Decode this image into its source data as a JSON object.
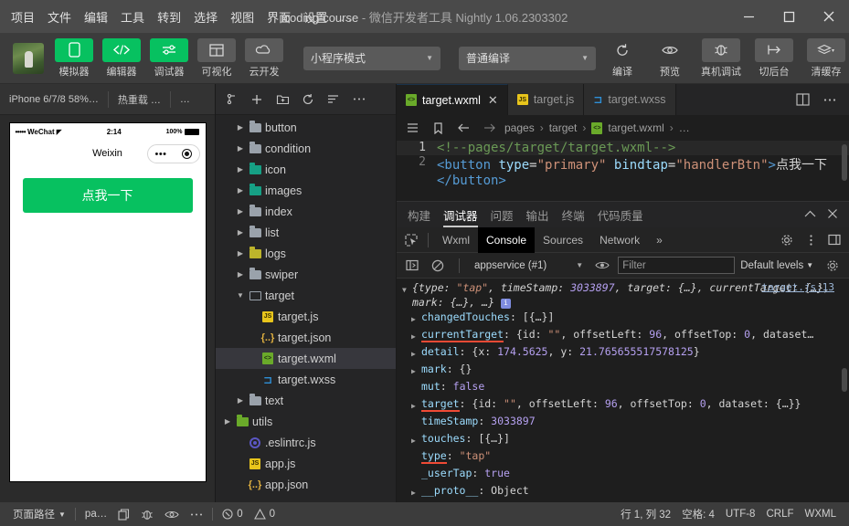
{
  "window": {
    "title_project": "icoding-course",
    "title_dash": "-",
    "title_app": "微信开发者工具",
    "title_version": "Nightly 1.06.2303302",
    "minimize": "minimize-icon",
    "maximize": "maximize-icon",
    "close": "close-icon"
  },
  "menu": {
    "items": [
      {
        "label": "项目"
      },
      {
        "label": "文件"
      },
      {
        "label": "编辑"
      },
      {
        "label": "工具"
      },
      {
        "label": "转到"
      },
      {
        "label": "选择"
      },
      {
        "label": "视图"
      },
      {
        "label": "界面"
      },
      {
        "label": "设置"
      },
      {
        "label": "…"
      }
    ]
  },
  "toolbar": {
    "left_buttons": [
      {
        "label": "模拟器",
        "icon": "phone-icon",
        "state": "green"
      },
      {
        "label": "编辑器",
        "icon": "code-icon",
        "state": "green"
      },
      {
        "label": "调试器",
        "icon": "sliders-icon",
        "state": "green"
      },
      {
        "label": "可视化",
        "icon": "layout-icon",
        "state": "grey"
      },
      {
        "label": "云开发",
        "icon": "cloud-icon",
        "state": "grey"
      }
    ],
    "mode_select": "小程序模式",
    "compile_select": "普通编译",
    "right_buttons": [
      {
        "label": "编译",
        "icon": "refresh-icon"
      },
      {
        "label": "预览",
        "icon": "eye-icon"
      },
      {
        "label": "真机调试",
        "icon": "bug-icon"
      },
      {
        "label": "切后台",
        "icon": "background-icon"
      },
      {
        "label": "清缓存",
        "icon": "layers-icon"
      }
    ],
    "overflow": "»"
  },
  "simulator": {
    "device": "iPhone 6/7/8 58%…",
    "hot_reload": "热重载 …",
    "more": "…",
    "phone": {
      "carrier": "WeChat",
      "signal_dots": "•••••",
      "wifi_icon": "wifi-icon",
      "time": "2:14",
      "battery_pct": "100%",
      "nav_title": "Weixin",
      "capsule_more": "•••",
      "capsule_target": "target-icon",
      "button_label": "点我一下"
    }
  },
  "explorer": {
    "toolbar_icons": [
      "collapse-icon",
      "new-file-icon",
      "new-folder-icon",
      "refresh-icon",
      "sort-icon",
      "more-icon"
    ],
    "tree": [
      {
        "label": "button",
        "type": "folder",
        "icon": "folder-grey",
        "arrow": "right",
        "indent": 1,
        "selected": false
      },
      {
        "label": "condition",
        "type": "folder",
        "icon": "folder-grey",
        "arrow": "right",
        "indent": 1,
        "selected": false
      },
      {
        "label": "icon",
        "type": "folder",
        "icon": "folder-teal",
        "arrow": "right",
        "indent": 1,
        "selected": false
      },
      {
        "label": "images",
        "type": "folder",
        "icon": "folder-teal",
        "arrow": "right",
        "indent": 1,
        "selected": false
      },
      {
        "label": "index",
        "type": "folder",
        "icon": "folder-grey",
        "arrow": "right",
        "indent": 1,
        "selected": false
      },
      {
        "label": "list",
        "type": "folder",
        "icon": "folder-grey",
        "arrow": "right",
        "indent": 1,
        "selected": false
      },
      {
        "label": "logs",
        "type": "folder",
        "icon": "folder-yellow",
        "arrow": "right",
        "indent": 1,
        "selected": false
      },
      {
        "label": "swiper",
        "type": "folder",
        "icon": "folder-grey",
        "arrow": "right",
        "indent": 1,
        "selected": false
      },
      {
        "label": "target",
        "type": "folder-open",
        "icon": "folder-open",
        "arrow": "down",
        "indent": 1,
        "selected": false
      },
      {
        "label": "target.js",
        "type": "file",
        "icon": "js-icon",
        "arrow": "none",
        "indent": 2,
        "selected": false
      },
      {
        "label": "target.json",
        "type": "file",
        "icon": "json-icon",
        "arrow": "none",
        "indent": 2,
        "selected": false
      },
      {
        "label": "target.wxml",
        "type": "file",
        "icon": "wxml-icon",
        "arrow": "none",
        "indent": 2,
        "selected": true
      },
      {
        "label": "target.wxss",
        "type": "file",
        "icon": "wxss-icon",
        "arrow": "none",
        "indent": 2,
        "selected": false
      },
      {
        "label": "text",
        "type": "folder",
        "icon": "folder-grey",
        "arrow": "right",
        "indent": 1,
        "selected": false
      },
      {
        "label": "utils",
        "type": "folder",
        "icon": "folder-green",
        "arrow": "right",
        "indent": 0,
        "selected": false
      },
      {
        "label": ".eslintrc.js",
        "type": "file",
        "icon": "eslint-icon",
        "arrow": "none",
        "indent": 1,
        "selected": false
      },
      {
        "label": "app.js",
        "type": "file",
        "icon": "js-icon",
        "arrow": "none",
        "indent": 1,
        "selected": false
      },
      {
        "label": "app.json",
        "type": "file",
        "icon": "json-icon",
        "arrow": "none",
        "indent": 1,
        "selected": false
      }
    ]
  },
  "editor": {
    "tabs": [
      {
        "label": "target.wxml",
        "icon": "wxml-icon",
        "active": true,
        "closable": true
      },
      {
        "label": "target.js",
        "icon": "js-icon",
        "active": false,
        "closable": false
      },
      {
        "label": "target.wxss",
        "icon": "wxss-icon",
        "active": false,
        "closable": false
      }
    ],
    "tab_actions": [
      "split-editor-icon",
      "more-icon"
    ],
    "breadcrumb": {
      "nav_icons": [
        "outline-icon",
        "bookmark-icon",
        "back-icon",
        "forward-icon"
      ],
      "parts": [
        "pages",
        "target",
        "target.wxml",
        "…"
      ],
      "separator": "›",
      "file_icon": "wxml-icon"
    },
    "lines": [
      {
        "number": "1",
        "highlight": true,
        "tokens": [
          {
            "text": "<!--",
            "cls": "c-comment br"
          },
          {
            "text": "pages/target/target.wxml",
            "cls": "c-comment"
          },
          {
            "text": "-->",
            "cls": "c-comment br"
          }
        ]
      },
      {
        "number": "2",
        "highlight": false,
        "tokens": [
          {
            "text": "<button",
            "cls": "c-tag"
          },
          {
            "text": " ",
            "cls": "c-txt"
          },
          {
            "text": "type",
            "cls": "c-attr"
          },
          {
            "text": "=",
            "cls": "c-txt"
          },
          {
            "text": "\"primary\"",
            "cls": "c-str"
          },
          {
            "text": " ",
            "cls": "c-txt"
          },
          {
            "text": "bindtap",
            "cls": "c-attr"
          },
          {
            "text": "=",
            "cls": "c-txt"
          },
          {
            "text": "\"handlerBtn\"",
            "cls": "c-str"
          },
          {
            "text": ">",
            "cls": "c-tag"
          },
          {
            "text": "点我一下",
            "cls": "c-txt"
          },
          {
            "text": "</button>",
            "cls": "c-tag"
          }
        ]
      }
    ]
  },
  "debugger": {
    "panel_tabs": [
      {
        "label": "构建",
        "active": false
      },
      {
        "label": "调试器",
        "active": true
      },
      {
        "label": "问题",
        "active": false
      },
      {
        "label": "输出",
        "active": false
      },
      {
        "label": "终端",
        "active": false
      },
      {
        "label": "代码质量",
        "active": false
      }
    ],
    "panel_actions": [
      "chevron-up-icon",
      "close-icon"
    ],
    "devtools_tabs": [
      {
        "label": "Wxml",
        "active": false
      },
      {
        "label": "Console",
        "active": true
      },
      {
        "label": "Sources",
        "active": false
      },
      {
        "label": "Network",
        "active": false
      },
      {
        "label": "»",
        "active": false
      }
    ],
    "devtools_left_icon": "inspect-icon",
    "devtools_right_icons": [
      "gear-icon",
      "kebab-icon",
      "dock-icon"
    ],
    "console_toolbar": {
      "sidebar_icon": "console-sidebar-icon",
      "clear_icon": "clear-console-icon",
      "context": "appservice (#1)",
      "eye_icon": "eye-icon",
      "filter_placeholder": "Filter",
      "levels": "Default levels",
      "settings_icon": "gear-icon"
    },
    "console": {
      "source_link": "target.js:13",
      "rows": [
        {
          "tri": "down",
          "italic": true,
          "tokens": [
            {
              "t": "{type: ",
              "c": "p"
            },
            {
              "t": "\"tap\"",
              "c": "s"
            },
            {
              "t": ", timeStamp: ",
              "c": "p"
            },
            {
              "t": "3033897",
              "c": "n"
            },
            {
              "t": ", target: {…}, currentTarget: {…}, mark: {…}, …} ",
              "c": "p"
            },
            {
              "t": "i",
              "c": "badge"
            }
          ]
        },
        {
          "tri": "right",
          "indent": 1,
          "tokens": [
            {
              "t": "changedTouches",
              "c": "k"
            },
            {
              "t": ": [{…}]",
              "c": "p"
            }
          ]
        },
        {
          "tri": "right",
          "indent": 1,
          "tokens": [
            {
              "t": "currentTarget",
              "c": "k-u"
            },
            {
              "t": ": {id: ",
              "c": "p"
            },
            {
              "t": "\"\"",
              "c": "s"
            },
            {
              "t": ", offsetLeft: ",
              "c": "p"
            },
            {
              "t": "96",
              "c": "n"
            },
            {
              "t": ", offsetTop: ",
              "c": "p"
            },
            {
              "t": "0",
              "c": "n"
            },
            {
              "t": ", dataset…",
              "c": "p"
            }
          ]
        },
        {
          "tri": "right",
          "indent": 1,
          "tokens": [
            {
              "t": "detail",
              "c": "k"
            },
            {
              "t": ": {x: ",
              "c": "p"
            },
            {
              "t": "174.5625",
              "c": "n"
            },
            {
              "t": ", y: ",
              "c": "p"
            },
            {
              "t": "21.765655517578125",
              "c": "n"
            },
            {
              "t": "}",
              "c": "p"
            }
          ]
        },
        {
          "tri": "right",
          "indent": 1,
          "tokens": [
            {
              "t": "mark",
              "c": "k"
            },
            {
              "t": ": {}",
              "c": "p"
            }
          ]
        },
        {
          "tri": "none",
          "indent": 1,
          "tokens": [
            {
              "t": "mut",
              "c": "k"
            },
            {
              "t": ": ",
              "c": "p"
            },
            {
              "t": "false",
              "c": "b"
            }
          ]
        },
        {
          "tri": "right",
          "indent": 1,
          "tokens": [
            {
              "t": "target",
              "c": "k-u"
            },
            {
              "t": ": {id: ",
              "c": "p"
            },
            {
              "t": "\"\"",
              "c": "s"
            },
            {
              "t": ", offsetLeft: ",
              "c": "p"
            },
            {
              "t": "96",
              "c": "n"
            },
            {
              "t": ", offsetTop: ",
              "c": "p"
            },
            {
              "t": "0",
              "c": "n"
            },
            {
              "t": ", dataset: {…}}",
              "c": "p"
            }
          ]
        },
        {
          "tri": "none",
          "indent": 1,
          "tokens": [
            {
              "t": "timeStamp",
              "c": "k"
            },
            {
              "t": ": ",
              "c": "p"
            },
            {
              "t": "3033897",
              "c": "n"
            }
          ]
        },
        {
          "tri": "right",
          "indent": 1,
          "tokens": [
            {
              "t": "touches",
              "c": "k"
            },
            {
              "t": ": [{…}]",
              "c": "p"
            }
          ]
        },
        {
          "tri": "none",
          "indent": 1,
          "tokens": [
            {
              "t": "type",
              "c": "k-u"
            },
            {
              "t": ": ",
              "c": "p"
            },
            {
              "t": "\"tap\"",
              "c": "s"
            }
          ]
        },
        {
          "tri": "none",
          "indent": 1,
          "tokens": [
            {
              "t": "_userTap",
              "c": "k"
            },
            {
              "t": ": ",
              "c": "p"
            },
            {
              "t": "true",
              "c": "b"
            }
          ]
        },
        {
          "tri": "right",
          "indent": 1,
          "tokens": [
            {
              "t": "__proto__",
              "c": "k"
            },
            {
              "t": ": Object",
              "c": "p"
            }
          ]
        }
      ]
    }
  },
  "statusbar": {
    "page_path_label": "页面路径",
    "page_value": "pa…",
    "icons": [
      "copy-icon",
      "bug-icon",
      "eye-icon",
      "more-icon"
    ],
    "error_count": "0",
    "warning_count": "0",
    "cursor": "行 1, 列 32",
    "indent": "空格: 4",
    "encoding": "UTF-8",
    "eol": "CRLF",
    "language": "WXML"
  }
}
